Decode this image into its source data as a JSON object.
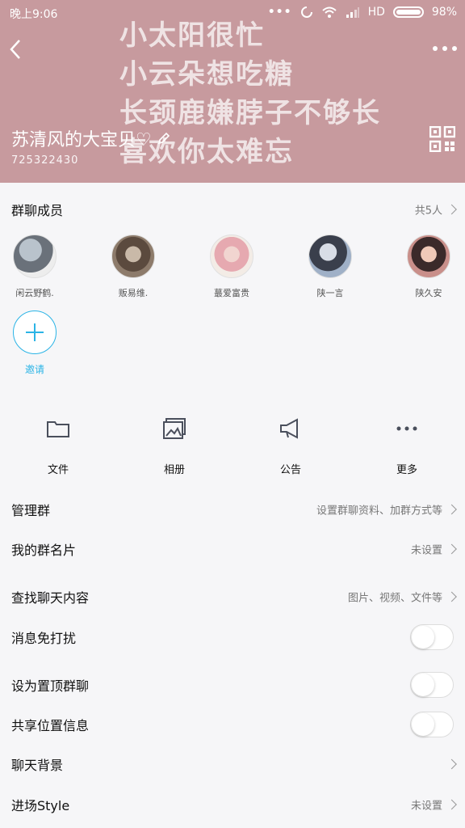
{
  "status_bar": {
    "time": "晚上9:06",
    "network": "HD",
    "battery": "98%"
  },
  "header": {
    "background_lines": [
      "小太阳很忙",
      "小云朵想吃糖",
      "长颈鹿嫌脖子不够长",
      "喜欢你太难忘"
    ],
    "group_name": "苏清风的大宝贝♡",
    "group_id": "725322430",
    "bg_color": "#c79a9e"
  },
  "members": {
    "title": "群聊成员",
    "count_label": "共5人",
    "list": [
      {
        "name": "闲云野鹤."
      },
      {
        "name": "贩易维."
      },
      {
        "name": "蕞爱富贵"
      },
      {
        "name": "陕一言"
      },
      {
        "name": "陕久安"
      }
    ],
    "invite_label": "邀请",
    "accent_color": "#2bb4e6"
  },
  "quick_actions": [
    {
      "label": "文件",
      "icon": "folder-icon"
    },
    {
      "label": "相册",
      "icon": "album-icon"
    },
    {
      "label": "公告",
      "icon": "megaphone-icon"
    },
    {
      "label": "更多",
      "icon": "more-dots-icon"
    }
  ],
  "settings": [
    {
      "title": "管理群",
      "value": "设置群聊资料、加群方式等"
    },
    {
      "title": "我的群名片",
      "value": "未设置"
    },
    {
      "title": "查找聊天内容",
      "value": "图片、视频、文件等"
    },
    {
      "title": "消息免打扰",
      "toggle": false
    },
    {
      "title": "设为置顶群聊",
      "toggle": false
    },
    {
      "title": "共享位置信息",
      "toggle": false
    },
    {
      "title": "聊天背景",
      "value": ""
    },
    {
      "title": "进场Style",
      "value": "未设置"
    }
  ]
}
